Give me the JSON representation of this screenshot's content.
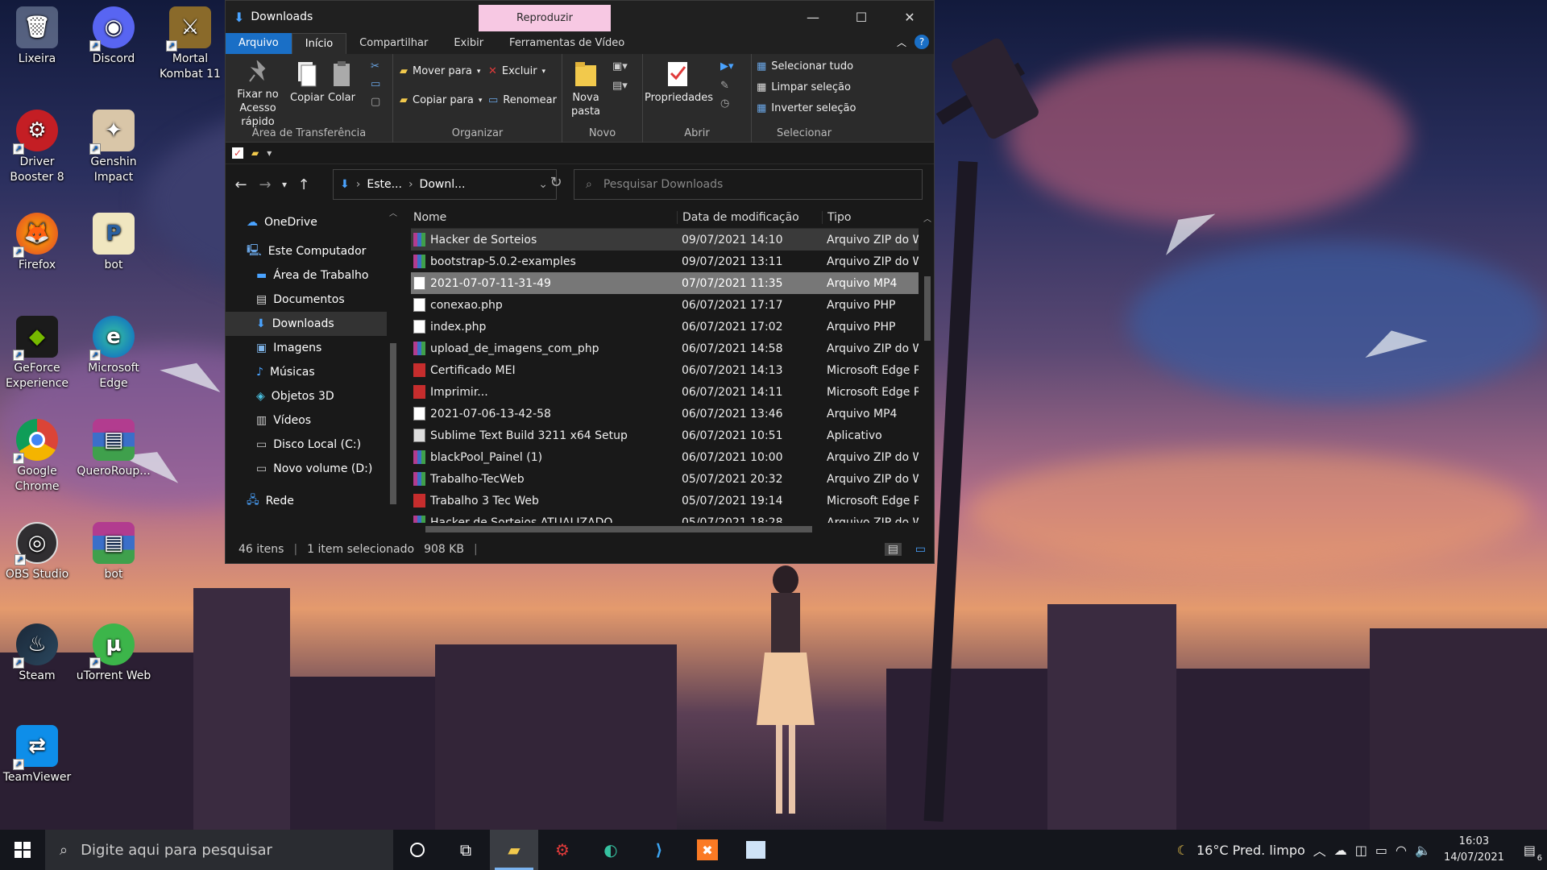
{
  "desktop": {
    "icons": [
      {
        "label": "Lixeira",
        "icon": "recycle-bin-icon"
      },
      {
        "label": "Discord",
        "icon": "discord-icon"
      },
      {
        "label": "Mortal Kombat 11",
        "icon": "game-icon"
      },
      {
        "label": "Driver Booster 8",
        "icon": "driver-booster-icon"
      },
      {
        "label": "Genshin Impact",
        "icon": "game-icon"
      },
      {
        "label": "Firefox",
        "icon": "firefox-icon"
      },
      {
        "label": "bot",
        "icon": "python-file-icon"
      },
      {
        "label": "GeForce Experience",
        "icon": "nvidia-icon"
      },
      {
        "label": "Microsoft Edge",
        "icon": "edge-icon"
      },
      {
        "label": "Google Chrome",
        "icon": "chrome-icon"
      },
      {
        "label": "QueroRoup...",
        "icon": "winrar-icon"
      },
      {
        "label": "OBS Studio",
        "icon": "obs-icon"
      },
      {
        "label": "bot",
        "icon": "winrar-icon"
      },
      {
        "label": "Steam",
        "icon": "steam-icon"
      },
      {
        "label": "uTorrent Web",
        "icon": "utorrent-icon"
      },
      {
        "label": "TeamViewer",
        "icon": "teamviewer-icon"
      }
    ]
  },
  "explorer": {
    "title": "Downloads",
    "context_tab": "Reproduzir",
    "tabs": [
      "Arquivo",
      "Início",
      "Compartilhar",
      "Exibir",
      "Ferramentas de Vídeo"
    ],
    "ribbon": {
      "clipboard": {
        "pin": "Fixar no Acesso rápido",
        "copy": "Copiar",
        "paste": "Colar",
        "group": "Área de Transferência"
      },
      "organize": {
        "move": "Mover para",
        "delete": "Excluir",
        "copy_to": "Copiar para",
        "rename": "Renomear",
        "group": "Organizar"
      },
      "new": {
        "new_folder": "Nova pasta",
        "group": "Novo"
      },
      "open": {
        "properties": "Propriedades",
        "group": "Abrir"
      },
      "select": {
        "select_all": "Selecionar tudo",
        "clear": "Limpar seleção",
        "invert": "Inverter seleção",
        "group": "Selecionar"
      }
    },
    "address": {
      "crumb1": "Este...",
      "crumb2": "Downl..."
    },
    "search_placeholder": "Pesquisar Downloads",
    "nav": [
      {
        "label": "OneDrive",
        "icon": "cloud-icon"
      },
      {
        "label": "Este Computador",
        "icon": "computer-icon"
      },
      {
        "label": "Área de Trabalho",
        "icon": "desktop-folder-icon"
      },
      {
        "label": "Documentos",
        "icon": "documents-icon"
      },
      {
        "label": "Downloads",
        "icon": "download-icon"
      },
      {
        "label": "Imagens",
        "icon": "pictures-icon"
      },
      {
        "label": "Músicas",
        "icon": "music-icon"
      },
      {
        "label": "Objetos 3D",
        "icon": "cube-icon"
      },
      {
        "label": "Vídeos",
        "icon": "videos-icon"
      },
      {
        "label": "Disco Local (C:)",
        "icon": "drive-icon"
      },
      {
        "label": "Novo volume (D:)",
        "icon": "drive-icon"
      },
      {
        "label": "Rede",
        "icon": "network-icon"
      }
    ],
    "columns": [
      "Nome",
      "Data de modificação",
      "Tipo"
    ],
    "files": [
      {
        "name": "Hacker de Sorteios",
        "date": "09/07/2021 14:10",
        "type": "Arquivo ZIP do W",
        "icon": "zip"
      },
      {
        "name": "bootstrap-5.0.2-examples",
        "date": "09/07/2021 13:11",
        "type": "Arquivo ZIP do W",
        "icon": "zip"
      },
      {
        "name": "2021-07-07-11-31-49",
        "date": "07/07/2021 11:35",
        "type": "Arquivo MP4",
        "icon": "mp4"
      },
      {
        "name": "conexao.php",
        "date": "06/07/2021 17:17",
        "type": "Arquivo PHP",
        "icon": "php"
      },
      {
        "name": "index.php",
        "date": "06/07/2021 17:02",
        "type": "Arquivo PHP",
        "icon": "php"
      },
      {
        "name": "upload_de_imagens_com_php",
        "date": "06/07/2021 14:58",
        "type": "Arquivo ZIP do W",
        "icon": "zip"
      },
      {
        "name": "Certificado MEI",
        "date": "06/07/2021 14:13",
        "type": "Microsoft Edge P",
        "icon": "pdf"
      },
      {
        "name": "Imprimir...",
        "date": "06/07/2021 14:11",
        "type": "Microsoft Edge P",
        "icon": "pdf"
      },
      {
        "name": "2021-07-06-13-42-58",
        "date": "06/07/2021 13:46",
        "type": "Arquivo MP4",
        "icon": "mp4"
      },
      {
        "name": "Sublime Text Build 3211 x64 Setup",
        "date": "06/07/2021 10:51",
        "type": "Aplicativo",
        "icon": "exe"
      },
      {
        "name": "blackPool_Painel (1)",
        "date": "06/07/2021 10:00",
        "type": "Arquivo ZIP do W",
        "icon": "zip"
      },
      {
        "name": "Trabalho-TecWeb",
        "date": "05/07/2021 20:32",
        "type": "Arquivo ZIP do W",
        "icon": "zip"
      },
      {
        "name": "Trabalho 3 Tec Web",
        "date": "05/07/2021 19:14",
        "type": "Microsoft Edge P",
        "icon": "pdf"
      },
      {
        "name": "Hacker de Sorteios ATUALIZADO",
        "date": "05/07/2021 18:28",
        "type": "Arquivo ZIP do W",
        "icon": "zip"
      }
    ],
    "status": {
      "count": "46 itens",
      "selected": "1 item selecionado",
      "size": "908 KB"
    }
  },
  "taskbar": {
    "search_placeholder": "Digite aqui para pesquisar",
    "weather": "16°C  Pred. limpo",
    "time": "16:03",
    "date": "14/07/2021",
    "notifications": "6"
  }
}
